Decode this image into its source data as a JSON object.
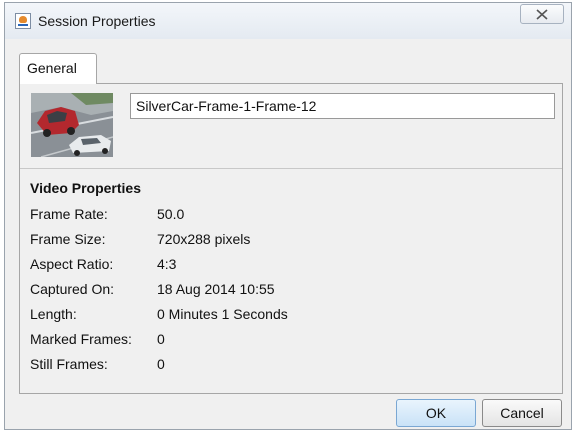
{
  "window": {
    "title": "Session Properties",
    "close_glyph": "✕"
  },
  "tabs": [
    {
      "label": "General",
      "selected": true
    }
  ],
  "general": {
    "session_name": "SilverCar-Frame-1-Frame-12",
    "thumbnail": "silver-car-thumbnail"
  },
  "video_properties": {
    "title": "Video Properties",
    "rows": [
      {
        "label": "Frame Rate:",
        "value": "50.0"
      },
      {
        "label": "Frame Size:",
        "value": "720x288 pixels"
      },
      {
        "label": "Aspect Ratio:",
        "value": "4:3"
      },
      {
        "label": "Captured On:",
        "value": "18 Aug 2014 10:55"
      },
      {
        "label": "Length:",
        "value": "0 Minutes 1 Seconds"
      },
      {
        "label": "Marked Frames:",
        "value": "0"
      },
      {
        "label": "Still Frames:",
        "value": "0"
      }
    ]
  },
  "buttons": {
    "ok": "OK",
    "cancel": "Cancel"
  },
  "colors": {
    "window_bg": "#f0f0f0",
    "ok_accent": "#c9e2f7"
  }
}
